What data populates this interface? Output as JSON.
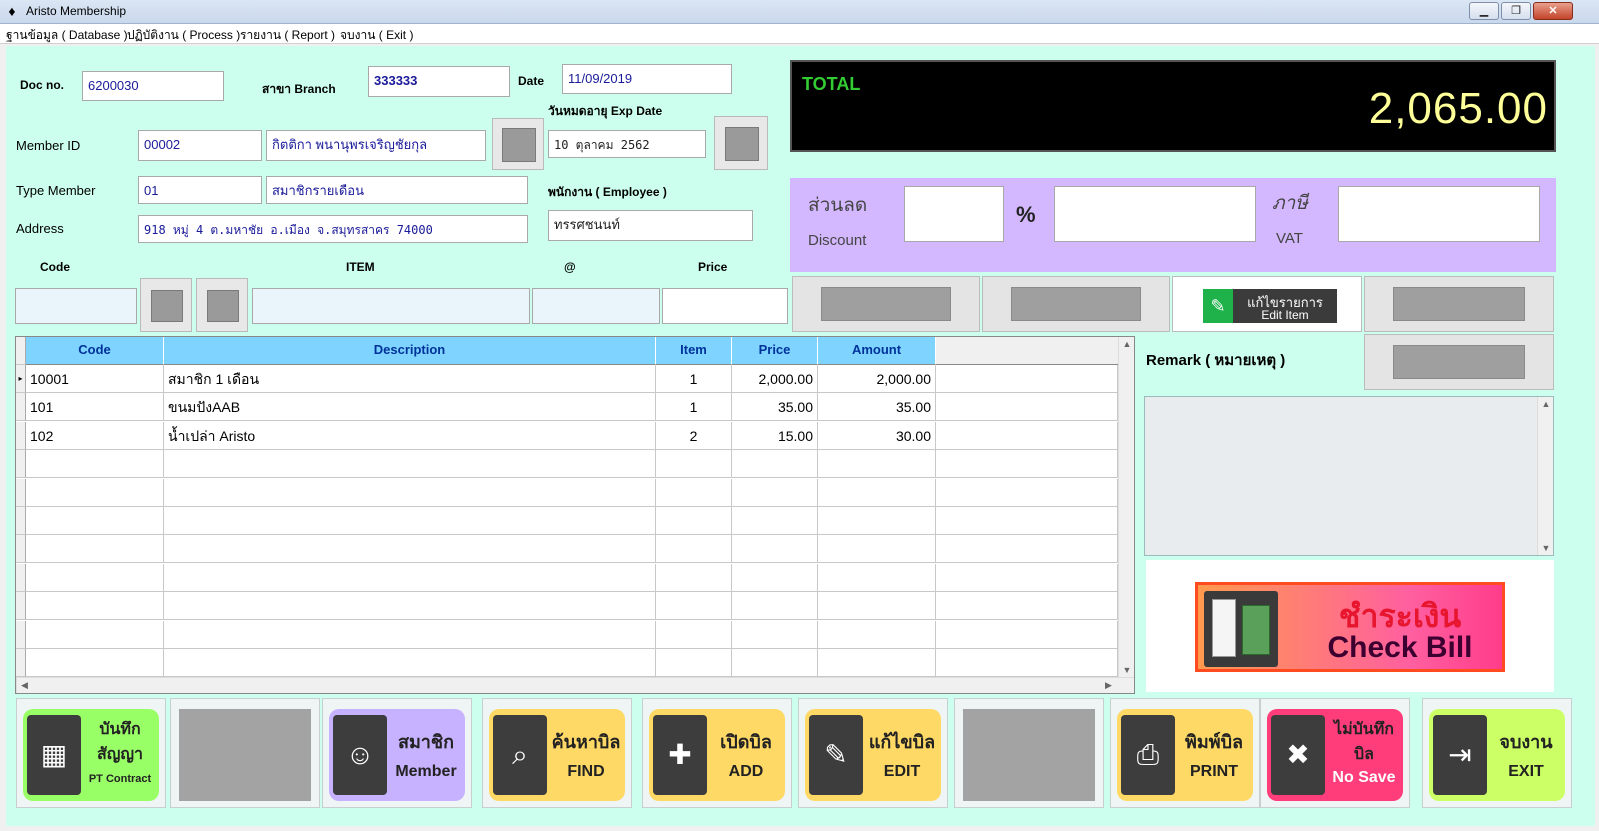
{
  "window": {
    "title": "Aristo Membership",
    "icon": "app-icon",
    "btn_min": "▁",
    "btn_max": "❐",
    "btn_close": "✕"
  },
  "menu": [
    {
      "label": "ฐานข้อมูล ( Database )"
    },
    {
      "label": "ปฏิบัติงาน ( Process )"
    },
    {
      "label": "รายงาน ( Report )"
    },
    {
      "label": "จบงาน ( Exit )"
    }
  ],
  "form": {
    "doc_label": "Doc no.",
    "doc_value": "6200030",
    "branch_label": "สาขา Branch",
    "branch_value": "333333",
    "date_label": "Date",
    "date_value": "11/09/2019",
    "exp_label": "วันหมดอายุ Exp Date",
    "exp_value": "10 ตุลาคม 2562",
    "member_label": "Member ID",
    "member_id": "00002",
    "member_name": "กิตติกา พนานุพรเจริญชัยกุล",
    "type_label": "Type Member",
    "type_code": "01",
    "type_name": "สมาชิกรายเดือน",
    "address_label": "Address",
    "address_value": "918 หมู่ 4 ต.มหาชัย อ.เมือง จ.สมุทรสาคร 74000",
    "employee_label": "พนักงาน ( Employee )",
    "employee_value": "ทรรศชนนท์"
  },
  "entry": {
    "code_label": "Code",
    "item_label": "ITEM",
    "at_label": "@",
    "price_label": "Price"
  },
  "total": {
    "label": "TOTAL",
    "value": "2,065.00"
  },
  "discount": {
    "thai": "ส่วนลด",
    "en": "Discount",
    "percent": "%",
    "vat_thai": "ภาษี",
    "vat_en": "VAT"
  },
  "edit_item": {
    "thai": "แก้ไขรายการ",
    "en": "Edit Item"
  },
  "remark_label": "Remark ( หมายเหตุ )",
  "grid": {
    "columns": [
      "Code",
      "Description",
      "Item",
      "Price",
      "Amount"
    ],
    "rows": [
      {
        "code": "10001",
        "desc": "สมาชิก 1 เดือน",
        "item": "1",
        "price": "2,000.00",
        "amount": "2,000.00"
      },
      {
        "code": "101",
        "desc": "ขนมปังAAB",
        "item": "1",
        "price": "35.00",
        "amount": "35.00"
      },
      {
        "code": "102",
        "desc": "น้ำเปล่า Aristo",
        "item": "2",
        "price": "15.00",
        "amount": "30.00"
      }
    ]
  },
  "check_bill": {
    "thai": "ชำระเงิน",
    "en": "Check Bill"
  },
  "toolbar": [
    {
      "id": "pt-contract",
      "t1": "บันทึก สัญญา",
      "t2": "PT Contract",
      "color": "#99ff66",
      "icon": "calculator-icon"
    },
    {
      "id": "placeholder-1"
    },
    {
      "id": "member",
      "t1": "สมาชิก",
      "t2": "Member",
      "color": "#c6b2ff",
      "icon": "person-icon"
    },
    {
      "id": "find",
      "t1": "ค้นหาบิล",
      "t2": "FIND",
      "color": "#ffd966",
      "icon": "search-document-icon"
    },
    {
      "id": "add",
      "t1": "เปิดบิล",
      "t2": "ADD",
      "color": "#ffd966",
      "icon": "add-document-icon"
    },
    {
      "id": "edit",
      "t1": "แก้ไขบิล",
      "t2": "EDIT",
      "color": "#ffd966",
      "icon": "edit-document-icon"
    },
    {
      "id": "placeholder-2"
    },
    {
      "id": "print",
      "t1": "พิมพ์บิล",
      "t2": "PRINT",
      "color": "#ffd966",
      "icon": "printer-icon"
    },
    {
      "id": "nosave",
      "t1": "ไม่บันทึก บิล",
      "t2": "No Save",
      "color": "#ff3d7a",
      "icon": "cancel-document-icon"
    },
    {
      "id": "exit",
      "t1": "จบงาน",
      "t2": "EXIT",
      "color": "#ccff66",
      "icon": "exit-door-icon"
    }
  ]
}
